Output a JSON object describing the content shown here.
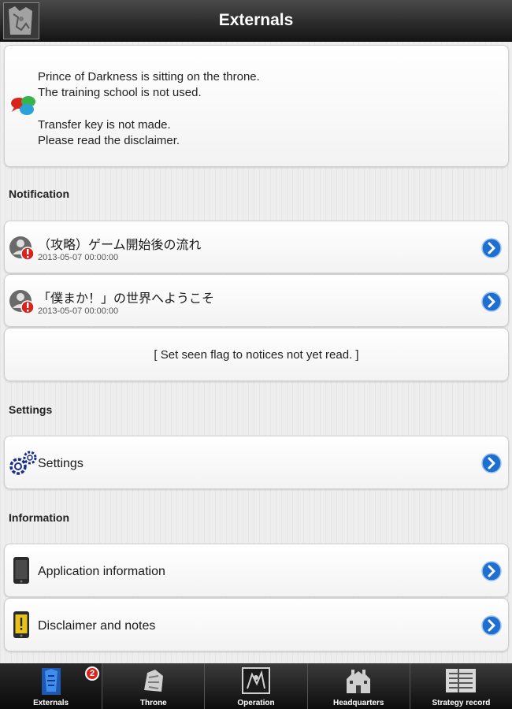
{
  "header": {
    "title": "Externals"
  },
  "status": {
    "line1": "Prince of Darkness is sitting on the throne.",
    "line2": "The training school is not used.",
    "line3": "Transfer key is not made.",
    "line4": "Please read the disclaimer."
  },
  "notification": {
    "header": "Notification",
    "items": [
      {
        "title": "（攻略）ゲーム開始後の流れ",
        "date": "2013-05-07 00:00:00"
      },
      {
        "title": "「僕まか！」の世界へようこそ",
        "date": "2013-05-07 00:00:00"
      }
    ],
    "mark_read_label": "[ Set seen flag to notices not yet read. ]"
  },
  "settings": {
    "header": "Settings",
    "item_label": "Settings"
  },
  "information": {
    "header": "Information",
    "items": [
      {
        "label": "Application information",
        "icon": "phone-icon"
      },
      {
        "label": "Disclaimer and notes",
        "icon": "warning-phone-icon"
      }
    ]
  },
  "tabs": [
    {
      "label": "Externals",
      "icon": "externals-icon",
      "badge": "2",
      "active": true
    },
    {
      "label": "Throne",
      "icon": "throne-icon"
    },
    {
      "label": "Operation",
      "icon": "operation-icon"
    },
    {
      "label": "Headquarters",
      "icon": "headquarters-icon"
    },
    {
      "label": "Strategy record",
      "icon": "strategy-record-icon"
    }
  ],
  "colors": {
    "accent_blue": "#1f6fd1",
    "alert_red": "#d9231d",
    "bar_dark": "#141414"
  }
}
